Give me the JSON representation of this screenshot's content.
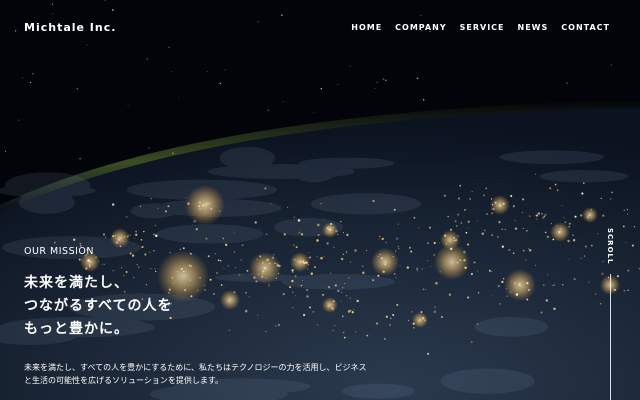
{
  "header": {
    "logo": "Michtale Inc.",
    "nav": [
      "HOME",
      "COMPANY",
      "SERVICE",
      "NEWS",
      "CONTACT"
    ]
  },
  "hero": {
    "label": "OUR MISSION",
    "headline": [
      "未来を満たし、",
      "つながるすべての人を",
      "もっと豊かに。"
    ],
    "description": [
      "未来を満たし、すべての人を豊かにするために、私たちはテクノロジーの力を活用し、ビジネス",
      "と生活の可能性を広げるソリューションを提供します。"
    ],
    "scroll_label": "SCROLL"
  },
  "colors": {
    "background": "#02040a",
    "earth_surface": "#1a2738",
    "city_lights": "#ffcf7a",
    "atmosphere_glow": "#6a8a3a",
    "text": "#ffffff"
  }
}
